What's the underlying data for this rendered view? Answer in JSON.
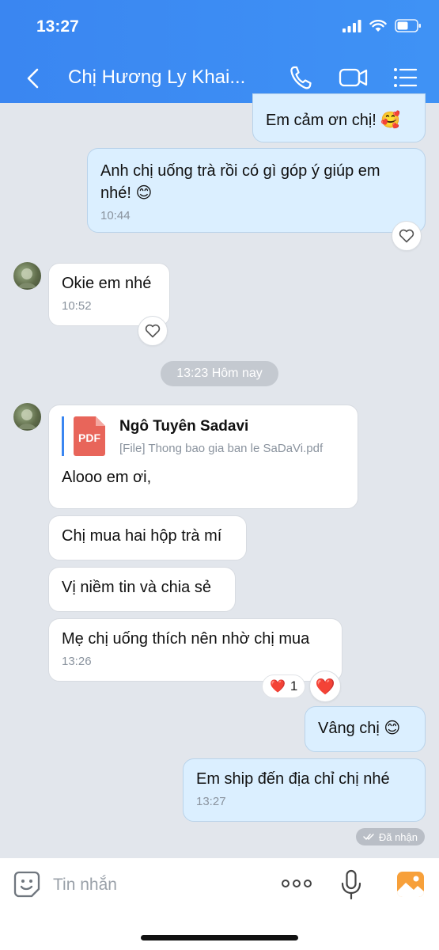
{
  "status": {
    "time": "13:27"
  },
  "header": {
    "title": "Chị Hương Ly Khai..."
  },
  "messages": {
    "m1": {
      "text": "Em cảm ơn chị! 🥰"
    },
    "m2": {
      "line1": "Anh chị uống trà rồi có gì góp ý giúp em",
      "line2": "nhé! 😊",
      "time": "10:44"
    },
    "m3": {
      "text": "Okie em nhé",
      "time": "10:52"
    },
    "date_separator": "13:23 Hôm nay",
    "m4": {
      "file_title": "Ngô Tuyên Sadavi",
      "file_subtitle": "[File] Thong bao gia ban le SaDaVi.pdf",
      "file_icon_label": "PDF",
      "text": "Alooo em ơi,"
    },
    "m5": {
      "text": "Chị mua hai hộp trà mí"
    },
    "m6": {
      "text": "Vị niềm tin và chia sẻ"
    },
    "m7": {
      "text": "Mẹ chị uống thích nên nhờ chị mua",
      "time": "13:26",
      "reaction_emoji": "❤️",
      "reaction_count": "1",
      "react_button_emoji": "❤️"
    },
    "m8": {
      "text": "Vâng chị 😊"
    },
    "m9": {
      "text": "Em ship đến địa chỉ chị nhé",
      "time": "13:27",
      "status": "Đã nhận"
    }
  },
  "composer": {
    "placeholder": "Tin nhắn",
    "more_label": "ooo"
  },
  "colors": {
    "header": "#3a86f1",
    "outgoing_bubble": "#dbefff",
    "incoming_bubble": "#ffffff",
    "background": "#e2e6ec",
    "pdf": "#e8655a"
  }
}
